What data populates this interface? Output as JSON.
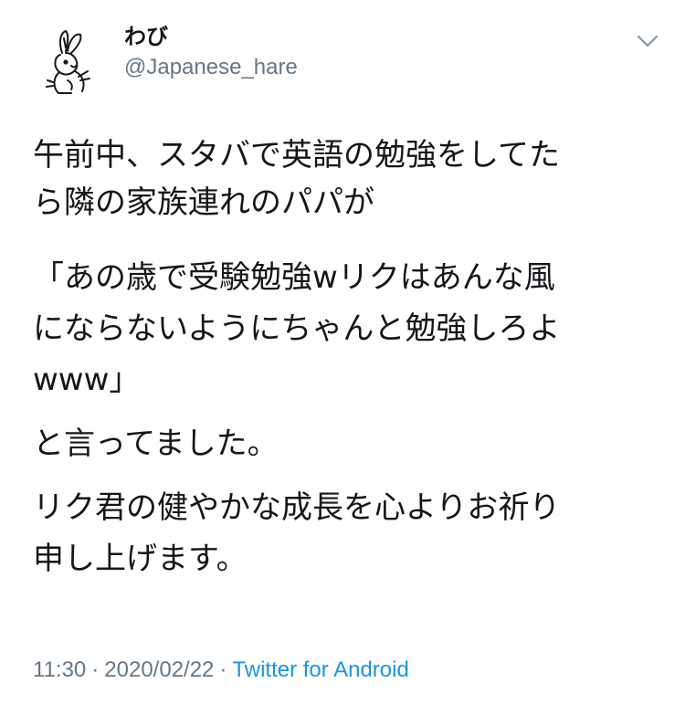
{
  "tweet": {
    "display_name": "わび",
    "handle": "@Japanese_hare",
    "body": {
      "p1": [
        "午前中、スタバで英語の勉強をしてた",
        "ら隣の家族連れのパパが"
      ],
      "p2": [
        "「あの歳で受験勉強wリクはあんな風",
        "にならないようにちゃんと勉強しろよ",
        "www」"
      ],
      "p3": [
        "と言ってました。"
      ],
      "p4": [
        "リク君の健やかな成長を心よりお祈り",
        "申し上げます。"
      ]
    },
    "time": "11:30",
    "separator": "·",
    "date": "2020/02/22",
    "source": "Twitter for Android"
  },
  "icons": {
    "avatar": "rabbit-drawing-avatar",
    "menu": "chevron-down-icon"
  },
  "colors": {
    "text": "#14171a",
    "secondary": "#657786",
    "link": "#1b95e0",
    "background": "#ffffff"
  }
}
